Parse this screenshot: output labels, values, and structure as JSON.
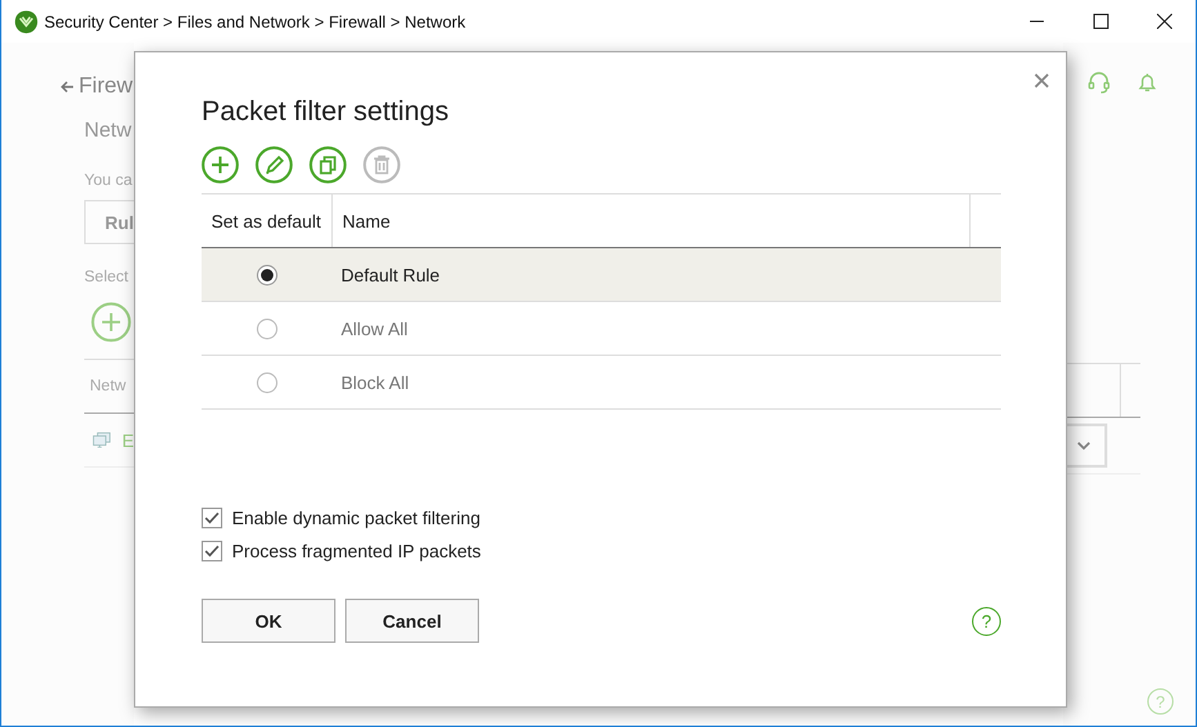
{
  "window": {
    "title": "Security Center > Files and Network > Firewall > Network"
  },
  "background": {
    "back_link": "Firew",
    "heading": "Netw",
    "description": "You ca",
    "rules_button": "Rul",
    "select_label": "Select",
    "table_header": "Netw",
    "row_text": "E",
    "help": "?"
  },
  "dialog": {
    "title": "Packet filter settings",
    "toolbar": [
      {
        "kind": "add",
        "disabled": false
      },
      {
        "kind": "edit",
        "disabled": false
      },
      {
        "kind": "copy",
        "disabled": false
      },
      {
        "kind": "delete",
        "disabled": true
      }
    ],
    "columns": [
      "Set as default",
      "Name"
    ],
    "rows": [
      {
        "name": "Default Rule",
        "selected": true
      },
      {
        "name": "Allow All",
        "selected": false
      },
      {
        "name": "Block All",
        "selected": false
      }
    ],
    "options": [
      {
        "label": "Enable dynamic packet filtering",
        "checked": true
      },
      {
        "label": "Process fragmented IP packets",
        "checked": true
      }
    ],
    "buttons": [
      "OK",
      "Cancel"
    ],
    "help": "?"
  }
}
